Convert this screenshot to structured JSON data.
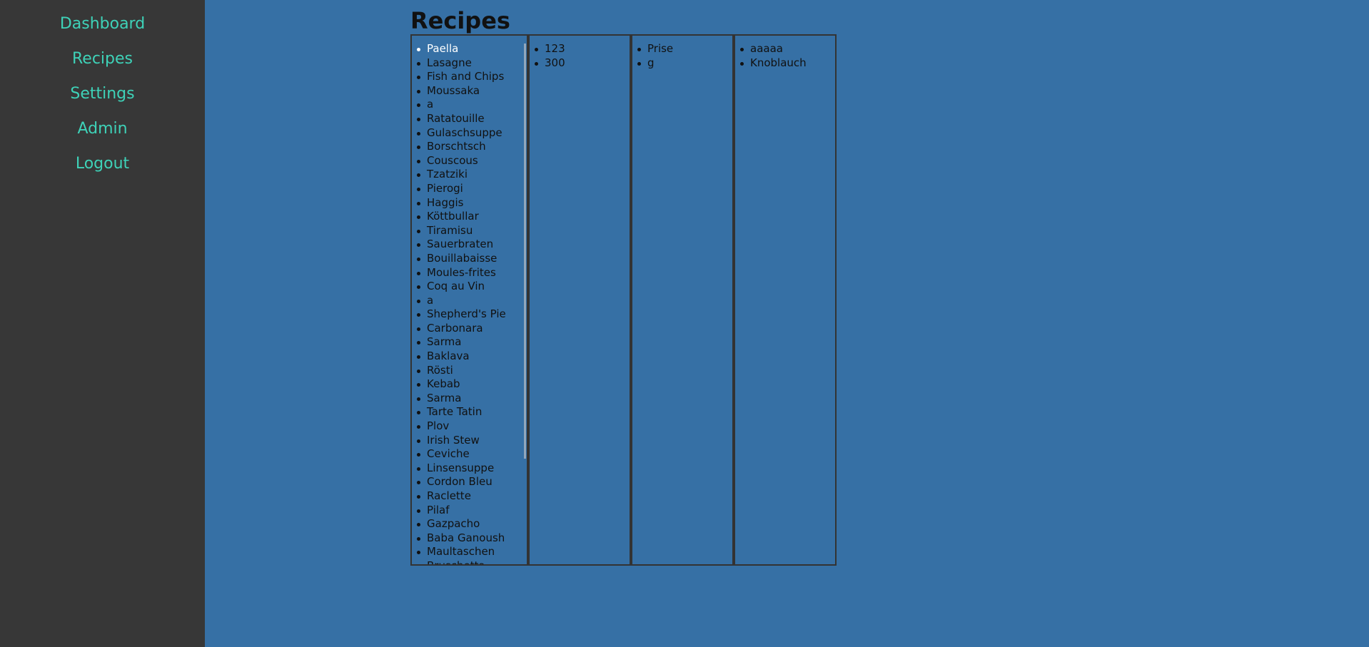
{
  "nav": {
    "items": [
      {
        "label": "Dashboard"
      },
      {
        "label": "Recipes"
      },
      {
        "label": "Settings"
      },
      {
        "label": "Admin"
      },
      {
        "label": "Logout"
      }
    ]
  },
  "page": {
    "title": "Recipes"
  },
  "recipes": {
    "selected": "Paella",
    "items": [
      "Paella",
      "Lasagne",
      "Fish and Chips",
      "Moussaka",
      "a",
      "Ratatouille",
      "Gulaschsuppe",
      "Borschtsch",
      "Couscous",
      "Tzatziki",
      "Pierogi",
      "Haggis",
      "Köttbullar",
      "Tiramisu",
      "Sauerbraten",
      "Bouillabaisse",
      "Moules-frites",
      "Coq au Vin",
      "a",
      "Shepherd's Pie",
      "Carbonara",
      "Sarma",
      "Baklava",
      "Rösti",
      "Kebab",
      "Sarma",
      "Tarte Tatin",
      "Plov",
      "Irish Stew",
      "Ceviche",
      "Linsensuppe",
      "Cordon Bleu",
      "Raclette",
      "Pilaf",
      "Gazpacho",
      "Baba Ganoush",
      "Maultaschen",
      "Bruschetta"
    ]
  },
  "amounts": {
    "items": [
      "123",
      "300"
    ]
  },
  "units": {
    "items": [
      "Prise",
      "g"
    ]
  },
  "ingredients": {
    "items": [
      "aaaaa",
      "Knoblauch"
    ]
  }
}
